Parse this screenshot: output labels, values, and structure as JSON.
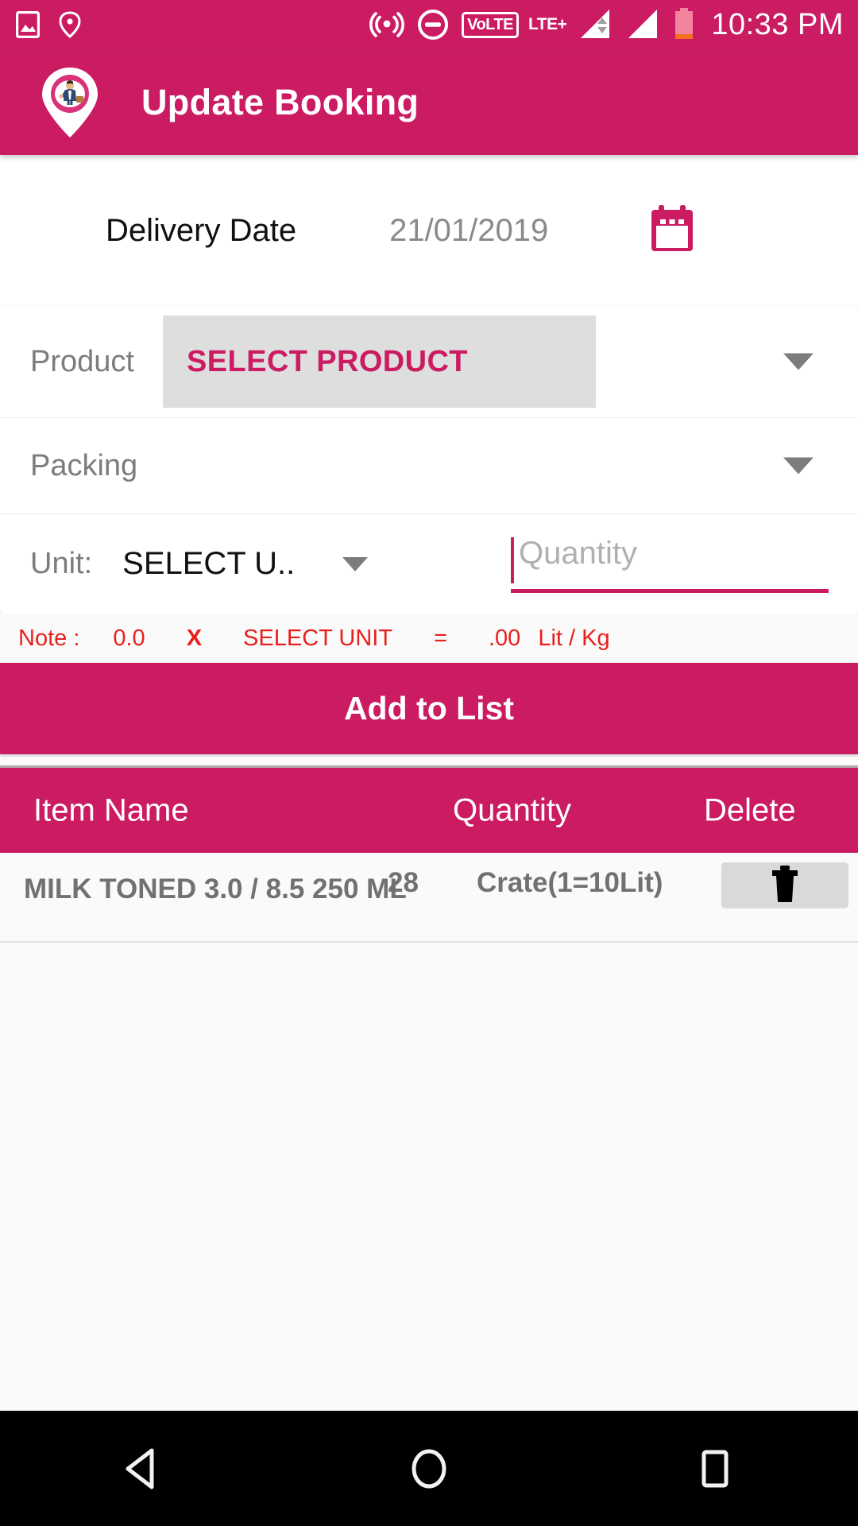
{
  "status_bar": {
    "icons": [
      "image-icon",
      "location-shield-icon",
      "hotspot-icon",
      "do-not-disturb-icon"
    ],
    "volte_label": "VoLTE",
    "network_label": "LTE+",
    "time": "10:33 PM"
  },
  "app_bar": {
    "logo": "map-pin-salesman-logo",
    "title": "Update Booking"
  },
  "delivery": {
    "label": "Delivery Date",
    "value": "21/01/2019",
    "calendar_icon": "calendar-icon"
  },
  "form": {
    "product": {
      "label": "Product",
      "value": "SELECT PRODUCT",
      "caret": "chevron-down-icon"
    },
    "packing": {
      "label": "Packing",
      "value": "",
      "caret": "chevron-down-icon"
    },
    "unit": {
      "label": "Unit:",
      "value": "SELECT U..",
      "caret": "chevron-down-icon"
    },
    "quantity": {
      "placeholder": "Quantity",
      "value": ""
    }
  },
  "note": {
    "label": "Note :",
    "number": "0.0",
    "multiply": "X",
    "unit": "SELECT UNIT",
    "equals": "=",
    "result": ".00",
    "uom": "Lit / Kg"
  },
  "add_button": {
    "label": "Add to List"
  },
  "table": {
    "headers": [
      "Item Name",
      "Quantity",
      "Delete"
    ],
    "rows": [
      {
        "item_name": "MILK TONED 3.0 / 8.5 250 ML",
        "quantity": "28",
        "unit": "Crate(1=10Lit)",
        "delete_icon": "trash-icon"
      }
    ]
  },
  "nav_bar": {
    "back": "back-triangle-icon",
    "home": "home-circle-icon",
    "recents": "recents-square-icon"
  },
  "colors": {
    "primary": "#CB1B63",
    "note_red": "#E8201C",
    "label_gray": "#7C7C7C",
    "background": "#FAFAFA"
  }
}
